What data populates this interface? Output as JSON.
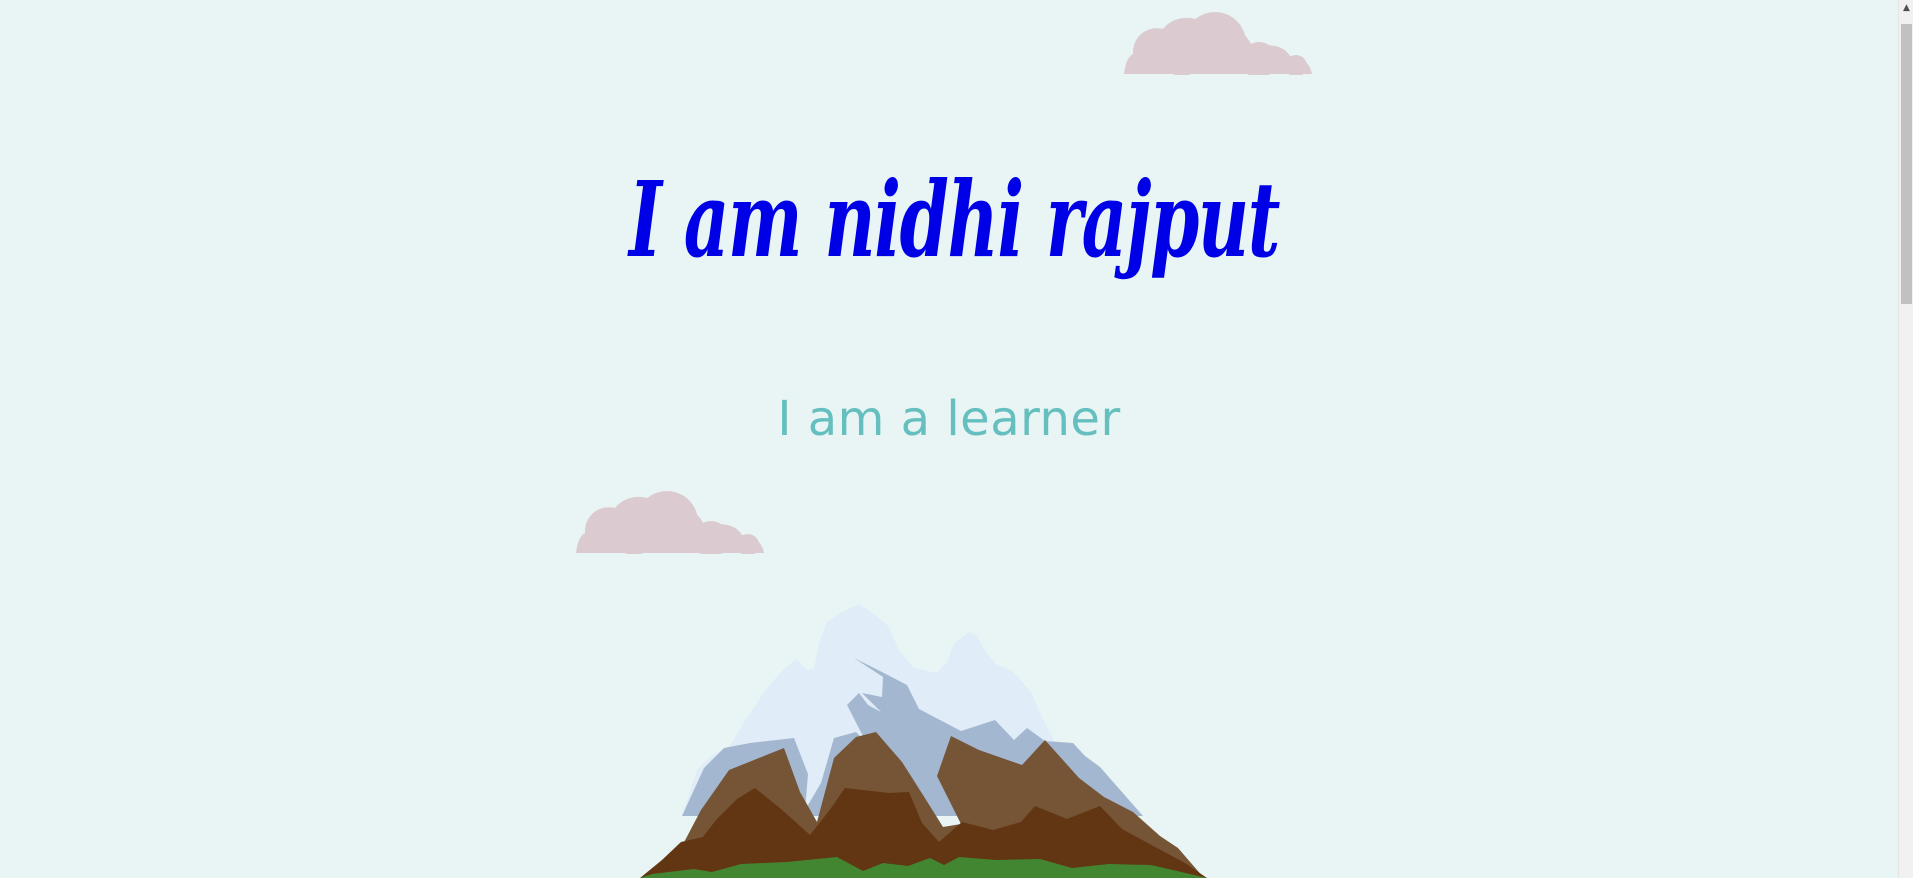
{
  "hero": {
    "title": "I am nidhi rajput",
    "subtitle": "I am a learner"
  },
  "decorations": {
    "top_cloud": "cloud-icon",
    "middle_cloud": "cloud-icon",
    "mountain": "mountain-illustration"
  },
  "scrollbar": {
    "up_arrow": "▲"
  },
  "colors": {
    "background": "#e8f5f4",
    "title": "#0000e6",
    "subtitle": "#66bfbf",
    "cloud": "#dbcbd0",
    "snow": "#e0ecf7",
    "shadow_snow": "#a3b8d0",
    "rock": "#765436",
    "dark_rock": "#623513",
    "grass": "#438632"
  }
}
